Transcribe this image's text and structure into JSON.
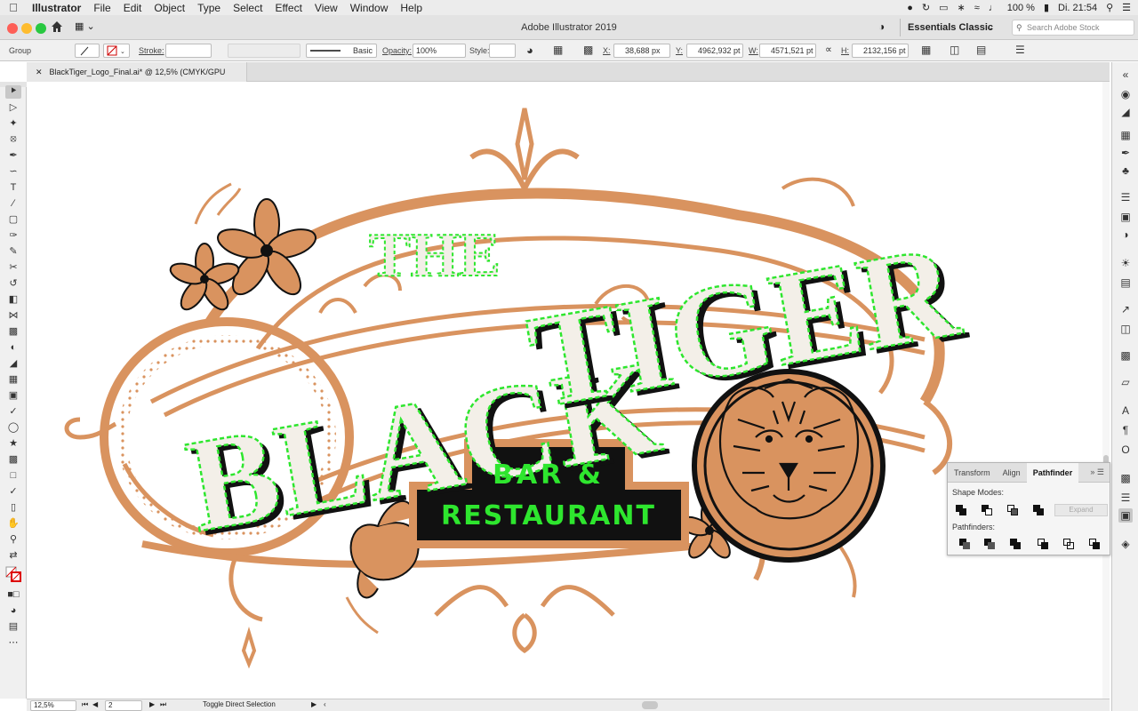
{
  "menubar": {
    "app": "Illustrator",
    "items": [
      "File",
      "Edit",
      "Object",
      "Type",
      "Select",
      "Effect",
      "View",
      "Window",
      "Help"
    ],
    "battery": "100 %",
    "clock": "Di. 21:54"
  },
  "window": {
    "title": "Adobe Illustrator 2019",
    "workspace": "Essentials Classic",
    "stock_placeholder": "Search Adobe Stock"
  },
  "control": {
    "selection": "Group",
    "stroke_label": "Stroke:",
    "stroke_profile": "Basic",
    "opacity_label": "Opacity:",
    "opacity": "100%",
    "style_label": "Style:",
    "x_label": "X:",
    "x": "38,688 px",
    "y_label": "Y:",
    "y": "4962,932 pt",
    "w_label": "W:",
    "w": "4571,521 pt",
    "h_label": "H:",
    "h": "2132,156 pt"
  },
  "doc": {
    "tab": "BlackTiger_Logo_Final.ai* @ 12,5% (CMYK/GPU Preview)"
  },
  "status": {
    "zoom": "12,5%",
    "artboard": "2",
    "tool": "Toggle Direct Selection"
  },
  "pathfinder": {
    "tabs": [
      "Transform",
      "Align",
      "Pathfinder"
    ],
    "shape_modes": "Shape Modes:",
    "pathfinders": "Pathfinders:",
    "expand": "Expand"
  },
  "artwork": {
    "the": "THE",
    "black": "BLACK",
    "tiger": "TIGER",
    "bar": "BAR &",
    "restaurant": "RESTAURANT"
  },
  "colors": {
    "accent": "#d9935f",
    "anchors": "#2ee62e",
    "ink": "#111111",
    "cream": "#f3efe8"
  }
}
